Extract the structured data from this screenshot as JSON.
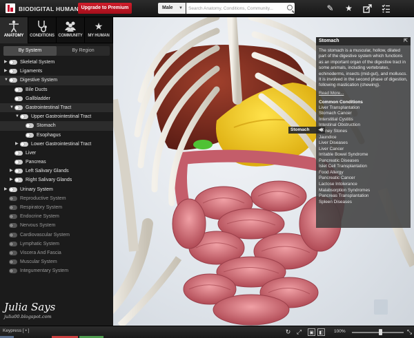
{
  "app": {
    "brand": "BIODIGITAL HUMAN",
    "premium_label": "Upgrade to Premium",
    "gender": "Male",
    "search_placeholder": "Search Anatomy, Conditions, Community..."
  },
  "toolbar_icons": [
    "pencil-icon",
    "star-icon",
    "share-icon",
    "checklist-icon"
  ],
  "nav_tabs": [
    {
      "label": "ANATOMY",
      "icon": "person-icon",
      "active": true
    },
    {
      "label": "CONDITIONS",
      "icon": "stethoscope-icon",
      "active": false
    },
    {
      "label": "COMMUNITY",
      "icon": "people-icon",
      "active": false
    },
    {
      "label": "MY HUMAN",
      "icon": "star-icon",
      "active": false
    }
  ],
  "view_toggle": {
    "by_system": "By System",
    "by_region": "By Region",
    "selected": "By System"
  },
  "tree": [
    {
      "label": "Skeletal System",
      "level": 0,
      "arrow": "right",
      "on": true,
      "highlight": false
    },
    {
      "label": "Ligaments",
      "level": 0,
      "arrow": "right",
      "on": true,
      "highlight": false
    },
    {
      "label": "Digestive System",
      "level": 0,
      "arrow": "down",
      "on": true,
      "highlight": true
    },
    {
      "label": "Bile Ducts",
      "level": 1,
      "arrow": "",
      "on": true,
      "highlight": false
    },
    {
      "label": "Gallbladder",
      "level": 1,
      "arrow": "",
      "on": true,
      "highlight": false
    },
    {
      "label": "Gastrointestinal Tract",
      "level": 1,
      "arrow": "down",
      "on": true,
      "highlight": true
    },
    {
      "label": "Upper Gastrointestinal Tract",
      "level": 2,
      "arrow": "down",
      "on": true,
      "highlight": false
    },
    {
      "label": "Stomach",
      "level": 3,
      "arrow": "",
      "on": true,
      "highlight": true
    },
    {
      "label": "Esophagus",
      "level": 3,
      "arrow": "",
      "on": true,
      "highlight": false
    },
    {
      "label": "Lower Gastrointestinal Tract",
      "level": 2,
      "arrow": "right",
      "on": true,
      "highlight": false
    },
    {
      "label": "Liver",
      "level": 1,
      "arrow": "",
      "on": true,
      "highlight": false
    },
    {
      "label": "Pancreas",
      "level": 1,
      "arrow": "",
      "on": true,
      "highlight": false
    },
    {
      "label": "Left Salivary Glands",
      "level": 1,
      "arrow": "right",
      "on": true,
      "highlight": false
    },
    {
      "label": "Right Salivary Glands",
      "level": 1,
      "arrow": "right",
      "on": true,
      "highlight": false
    },
    {
      "label": "Urinary System",
      "level": 0,
      "arrow": "right",
      "on": true,
      "highlight": false
    },
    {
      "label": "Reproductive System",
      "level": 0,
      "arrow": "",
      "on": false,
      "highlight": false
    },
    {
      "label": "Respiratory System",
      "level": 0,
      "arrow": "",
      "on": false,
      "highlight": false
    },
    {
      "label": "Endocrine System",
      "level": 0,
      "arrow": "",
      "on": false,
      "highlight": false
    },
    {
      "label": "Nervous System",
      "level": 0,
      "arrow": "",
      "on": false,
      "highlight": false
    },
    {
      "label": "Cardiovascular System",
      "level": 0,
      "arrow": "",
      "on": false,
      "highlight": false
    },
    {
      "label": "Lymphatic System",
      "level": 0,
      "arrow": "",
      "on": false,
      "highlight": false
    },
    {
      "label": "Viscera And Fascia",
      "level": 0,
      "arrow": "",
      "on": false,
      "highlight": false
    },
    {
      "label": "Muscular System",
      "level": 0,
      "arrow": "",
      "on": false,
      "highlight": false
    },
    {
      "label": "Integumentary System",
      "level": 0,
      "arrow": "",
      "on": false,
      "highlight": false
    }
  ],
  "watermark": {
    "title": "Julia Says",
    "subtitle": "julia00.blogspot.com"
  },
  "info_panel": {
    "title": "Stomach",
    "description": "The stomach is a muscular, hollow, dilated part of the digestive system which functions as an important organ of the digestive tract in some animals, including vertebrates, echinoderms, insects (mid-gut), and molluscs. It is involved in the second phase of digestion, following mastication (chewing).",
    "read_more": "Read More...",
    "conditions_title": "Common Conditions",
    "conditions": [
      "Liver Transplantation",
      "Stomach Cancer",
      "Interstitial Cystitis",
      "Intestinal Obstruction",
      "Kidney Stones",
      "Jaundice",
      "Liver Diseases",
      "Liver Cancer",
      "Irritable Bowel Syndrome",
      "Pancreatic Diseases",
      "Islet Cell Transplantation",
      "Food Allergy",
      "Pancreatic Cancer",
      "Lactose Intolerance",
      "Malabsorption Syndromes",
      "Pancreas Transplantation",
      "Spleen Diseases"
    ]
  },
  "structure_label": {
    "name": "Stomach"
  },
  "bottom_bar": {
    "keypress": "Keypress [ • ]",
    "zoom": "100%",
    "zoom_level": 0.55
  },
  "colors": {
    "brand_red": "#c8102e",
    "stomach": "#f4c81c",
    "liver": "#7a2a1e",
    "intestine": "#d4707a",
    "gallbladder": "#4fc234"
  }
}
